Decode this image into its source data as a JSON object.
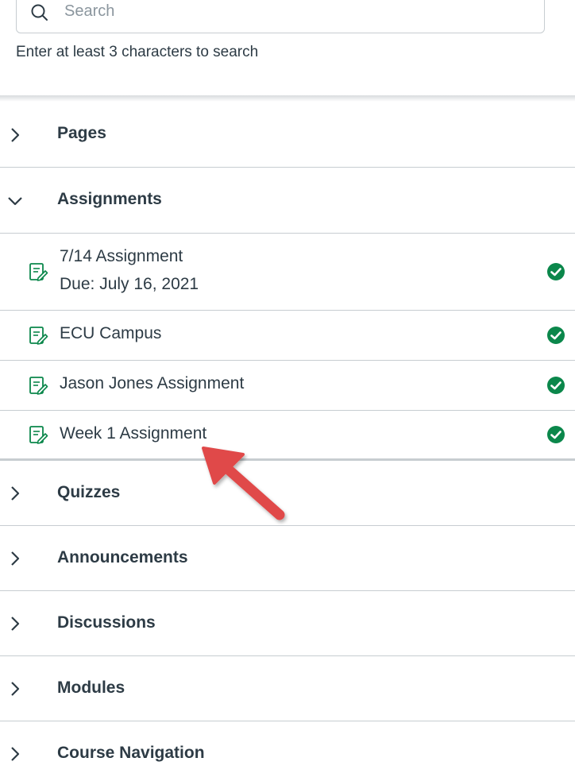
{
  "search": {
    "placeholder": "Search",
    "hint": "Enter at least 3 characters to search"
  },
  "sections": {
    "pages": {
      "label": "Pages",
      "expanded": false
    },
    "assignments": {
      "label": "Assignments",
      "expanded": true,
      "items": [
        {
          "title": "7/14 Assignment",
          "due": "Due: July 16, 2021",
          "icon": "assignment-icon",
          "status": "completed"
        },
        {
          "title": "ECU Campus",
          "icon": "assignment-icon",
          "status": "completed"
        },
        {
          "title": "Jason Jones Assignment",
          "icon": "assignment-icon",
          "status": "completed"
        },
        {
          "title": "Week 1 Assignment",
          "icon": "assignment-icon",
          "status": "completed"
        }
      ]
    },
    "quizzes": {
      "label": "Quizzes",
      "expanded": false
    },
    "announcements": {
      "label": "Announcements",
      "expanded": false
    },
    "discussions": {
      "label": "Discussions",
      "expanded": false
    },
    "modules": {
      "label": "Modules",
      "expanded": false
    },
    "course_navigation": {
      "label": "Course Navigation",
      "expanded": false
    }
  },
  "colors": {
    "text": "#2d3b45",
    "assignment_icon": "#0b874b",
    "check": "#0b874b",
    "divider": "#c7cdd1",
    "arrow": "#e04949"
  }
}
